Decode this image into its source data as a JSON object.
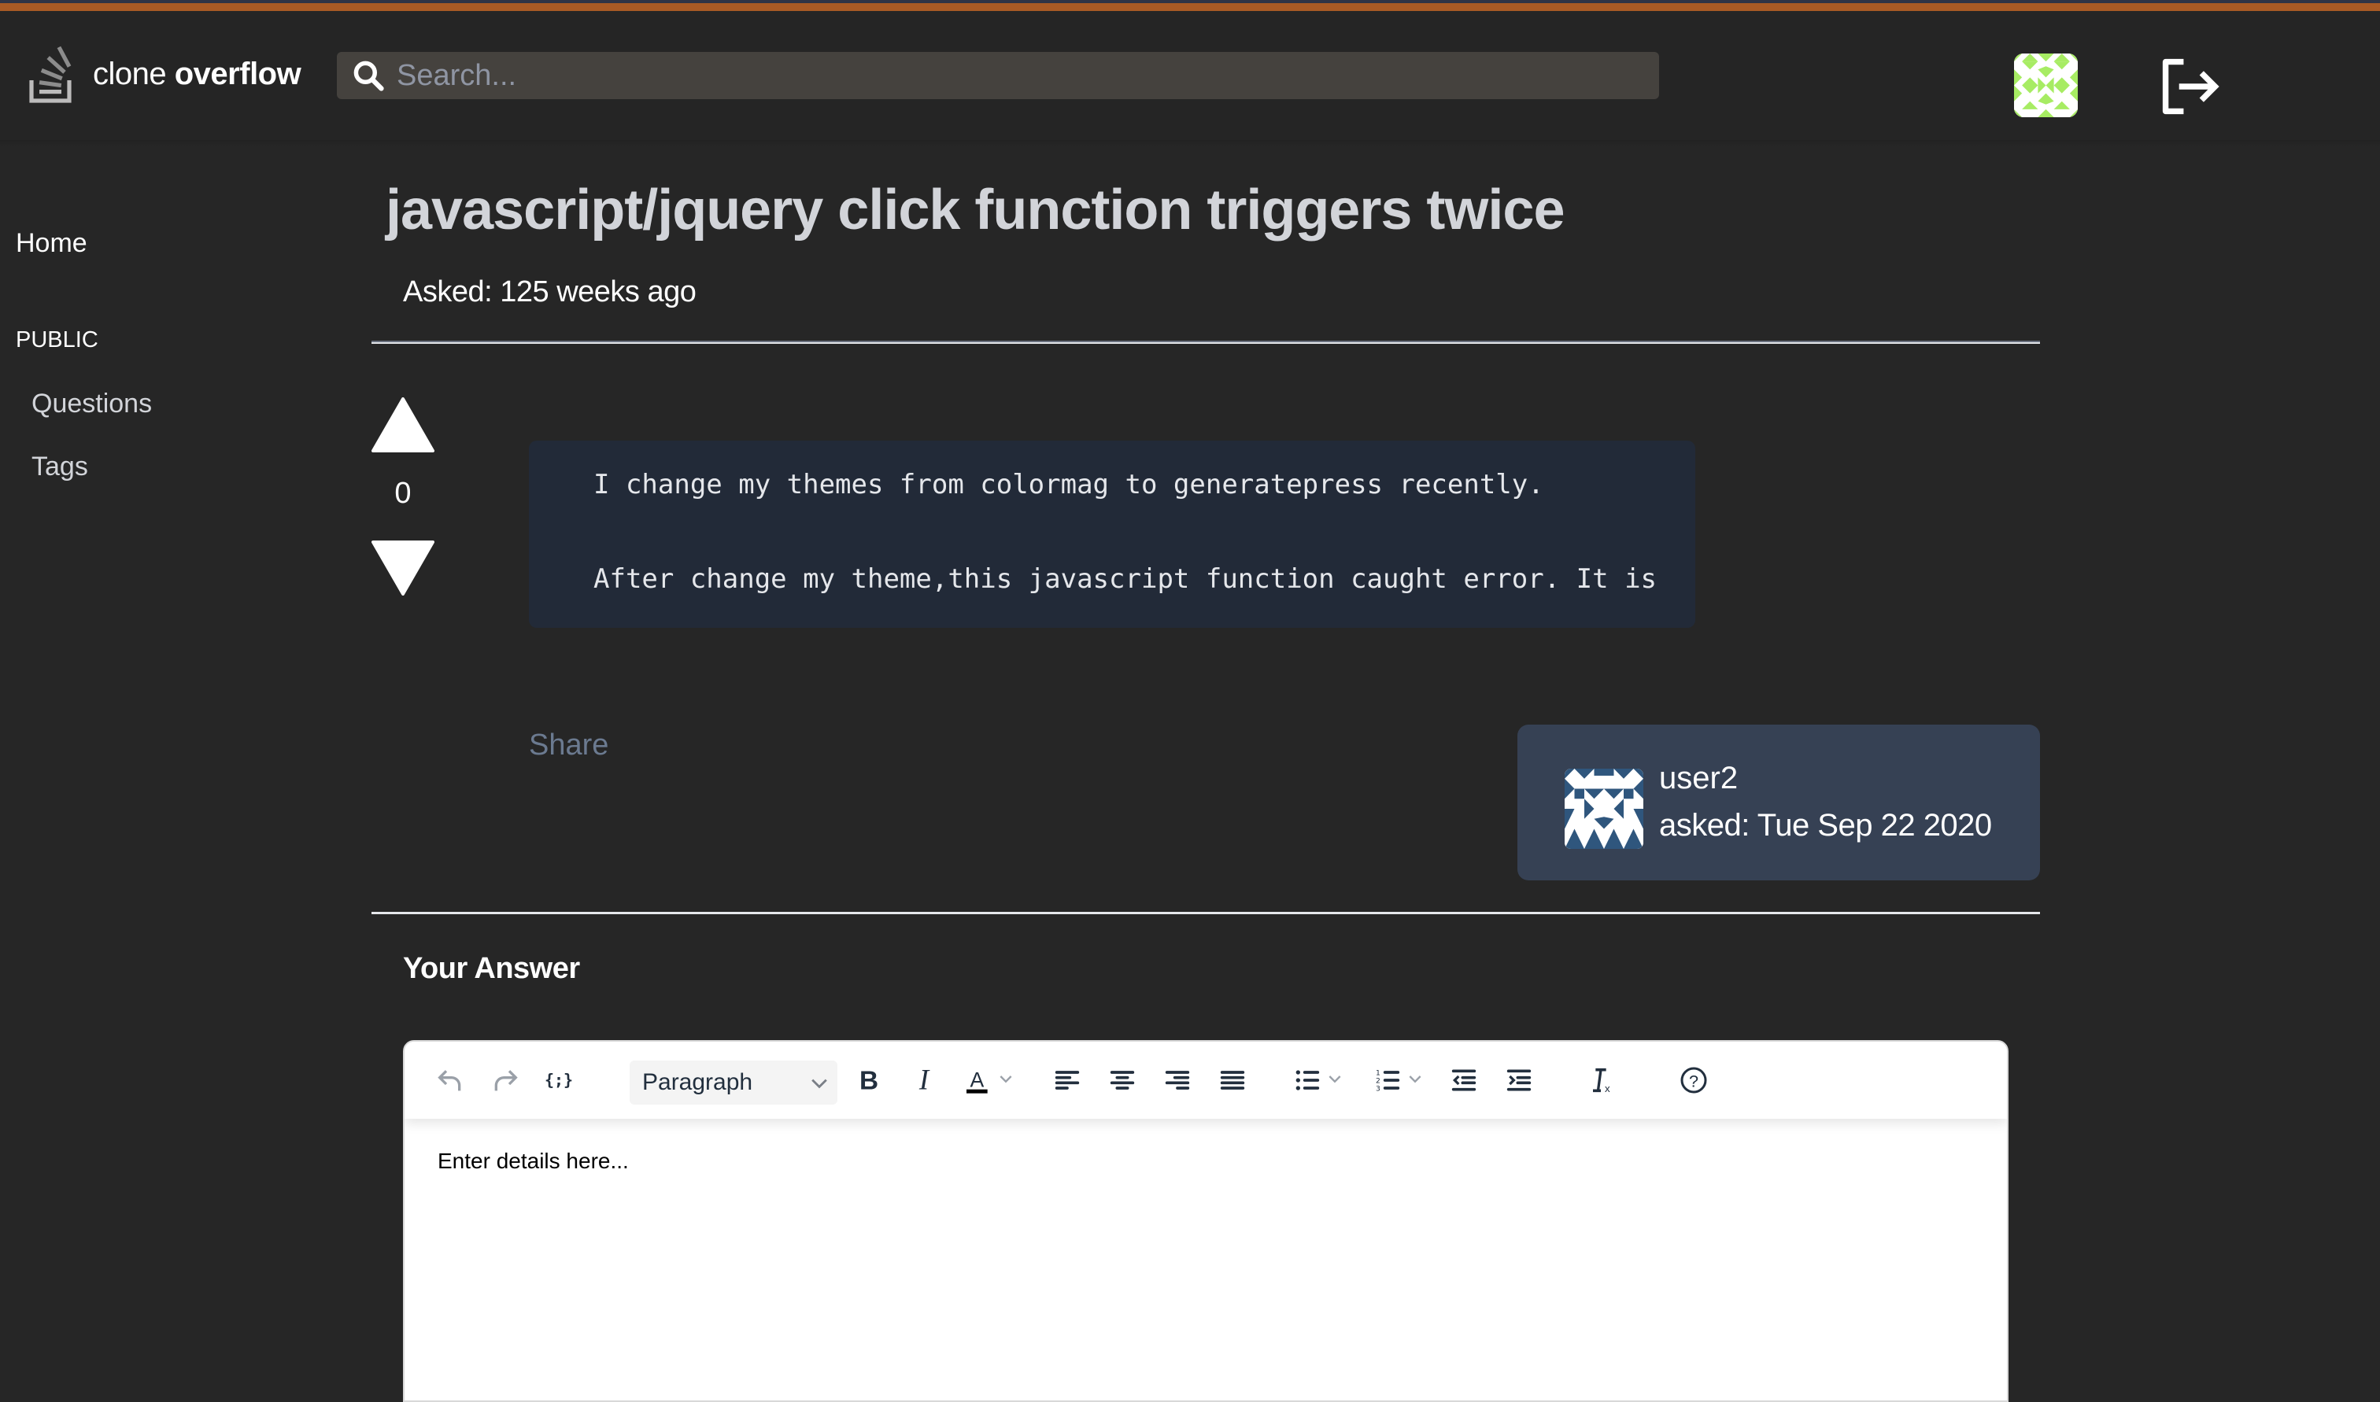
{
  "app": {
    "name_light": "clone",
    "name_bold": "overflow",
    "brand_color": "#a85a25"
  },
  "header": {
    "search_placeholder": "Search...",
    "search_value": "",
    "icons": [
      "search-icon",
      "user-avatar",
      "logout-icon"
    ]
  },
  "sidebar": {
    "home": "Home",
    "section_label": "PUBLIC",
    "items": [
      {
        "label": "Questions"
      },
      {
        "label": "Tags"
      }
    ]
  },
  "question": {
    "title": "javascript/jquery click function triggers twice",
    "asked_relative": "Asked: 125 weeks ago",
    "votes": "0",
    "body_lines": [
      "I change my themes from colormag to generatepress recently.",
      "After change my theme,this javascript function caught error. It is"
    ],
    "share_label": "Share",
    "author": {
      "name": "user2",
      "asked": "asked: Tue Sep 22 2020"
    }
  },
  "answer": {
    "heading": "Your Answer",
    "editor": {
      "format_value": "Paragraph",
      "placeholder": "Enter details here...",
      "toolbar": [
        "undo",
        "redo",
        "code-sample",
        "format",
        "bold",
        "italic",
        "text-color",
        "align-left",
        "align-center",
        "align-right",
        "justify",
        "bullet-list",
        "numbered-list",
        "outdent",
        "indent",
        "clear-formatting",
        "help"
      ]
    }
  }
}
